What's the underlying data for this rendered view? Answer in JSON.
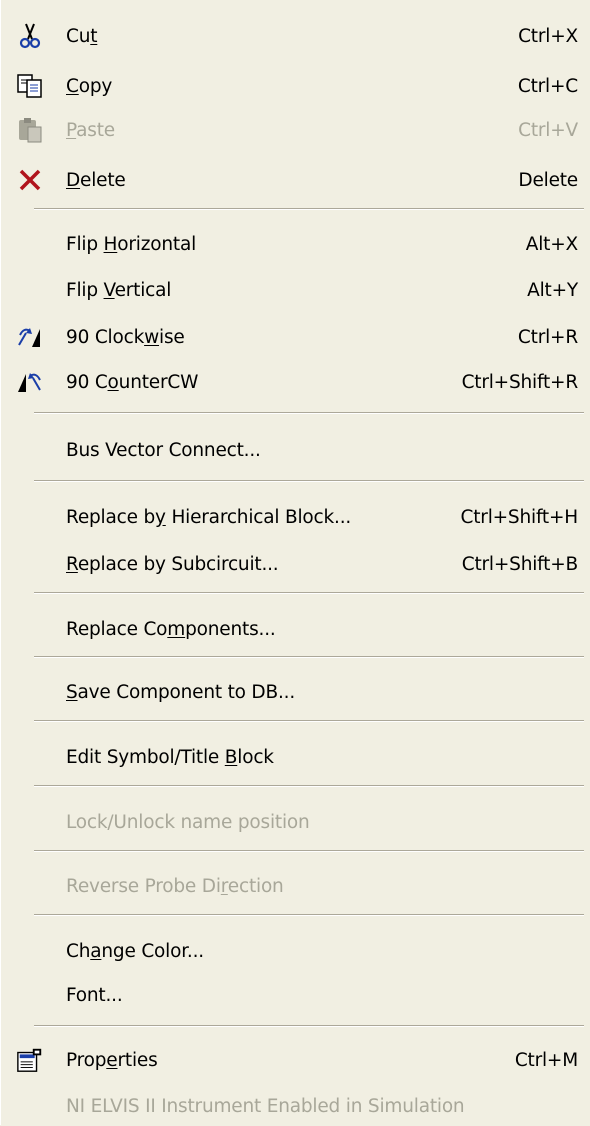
{
  "menu": {
    "items": [
      {
        "pre": "Cu",
        "acc": "t",
        "post": "",
        "shortcut": "Ctrl+X",
        "icon": "scissors-icon"
      },
      {
        "pre": "",
        "acc": "C",
        "post": "opy",
        "shortcut": "Ctrl+C",
        "icon": "copy-icon"
      },
      {
        "pre": "",
        "acc": "P",
        "post": "aste",
        "shortcut": "Ctrl+V",
        "icon": "paste-icon",
        "disabled": true
      },
      {
        "pre": "",
        "acc": "D",
        "post": "elete",
        "shortcut": "Delete",
        "icon": "delete-x-icon"
      },
      {
        "pre": "Flip ",
        "acc": "H",
        "post": "orizontal",
        "shortcut": "Alt+X"
      },
      {
        "pre": "Flip ",
        "acc": "V",
        "post": "ertical",
        "shortcut": "Alt+Y"
      },
      {
        "pre": "90 Clock",
        "acc": "w",
        "post": "ise",
        "shortcut": "Ctrl+R",
        "icon": "rotate-clockwise-icon"
      },
      {
        "pre": "90 C",
        "acc": "o",
        "post": "unterCW",
        "shortcut": "Ctrl+Shift+R",
        "icon": "rotate-counterclockwise-icon"
      },
      {
        "pre": "Bus Vector Connect...",
        "acc": "",
        "post": "",
        "shortcut": ""
      },
      {
        "pre": "Replace b",
        "acc": "y",
        "post": " Hierarchical Block...",
        "shortcut": "Ctrl+Shift+H"
      },
      {
        "pre": "",
        "acc": "R",
        "post": "eplace by Subcircuit...",
        "shortcut": "Ctrl+Shift+B"
      },
      {
        "pre": "Replace Co",
        "acc": "m",
        "post": "ponents...",
        "shortcut": ""
      },
      {
        "pre": "",
        "acc": "S",
        "post": "ave Component to DB...",
        "shortcut": ""
      },
      {
        "pre": "Edit Symbol/Title ",
        "acc": "B",
        "post": "lock",
        "shortcut": ""
      },
      {
        "pre": "Lock/Unlock name position",
        "acc": "",
        "post": "",
        "shortcut": "",
        "disabled": true
      },
      {
        "pre": "Reverse Probe Di",
        "acc": "r",
        "post": "ection",
        "shortcut": "",
        "disabled": true
      },
      {
        "pre": "Ch",
        "acc": "a",
        "post": "nge Color...",
        "shortcut": ""
      },
      {
        "pre": "Font...",
        "acc": "",
        "post": "",
        "shortcut": ""
      },
      {
        "pre": "Prop",
        "acc": "e",
        "post": "rties",
        "shortcut": "Ctrl+M",
        "icon": "properties-icon"
      },
      {
        "pre": "NI ELVIS II Instrument Enabled in Simulation",
        "acc": "",
        "post": "",
        "shortcut": "",
        "disabled": true
      }
    ]
  }
}
